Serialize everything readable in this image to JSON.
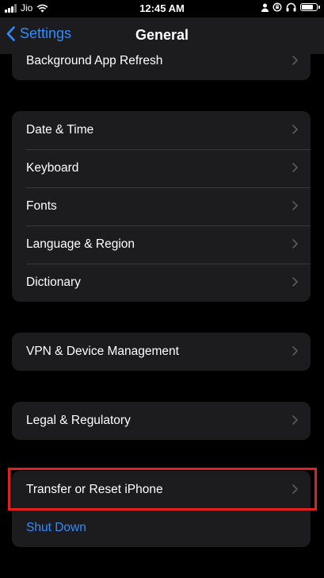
{
  "status_bar": {
    "carrier": "Jio",
    "time": "12:45 AM",
    "icons": [
      "signal-icon",
      "wifi-icon",
      "person-icon",
      "lock-rotation-icon",
      "headphones-icon",
      "battery-icon"
    ]
  },
  "nav": {
    "back_label": "Settings",
    "title": "General",
    "accent_color": "#2f8cff"
  },
  "groups": [
    {
      "items": [
        {
          "label": "Background App Refresh"
        }
      ]
    },
    {
      "items": [
        {
          "label": "Date & Time"
        },
        {
          "label": "Keyboard"
        },
        {
          "label": "Fonts"
        },
        {
          "label": "Language & Region"
        },
        {
          "label": "Dictionary"
        }
      ]
    },
    {
      "items": [
        {
          "label": "VPN & Device Management"
        }
      ]
    },
    {
      "items": [
        {
          "label": "Legal & Regulatory"
        }
      ]
    },
    {
      "items": [
        {
          "label": "Transfer or Reset iPhone"
        },
        {
          "label": "Shut Down"
        }
      ]
    }
  ],
  "highlight_color": "#e02020"
}
